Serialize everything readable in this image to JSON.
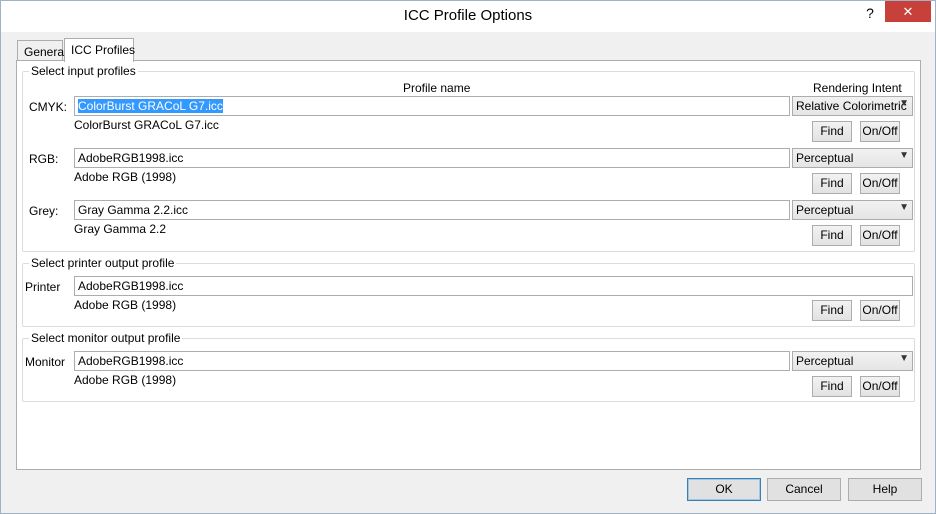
{
  "window": {
    "title": "ICC Profile Options",
    "help_glyph": "?",
    "close_glyph": "✕"
  },
  "tabs": [
    {
      "label": "General",
      "active": false
    },
    {
      "label": "ICC Profiles",
      "active": true
    }
  ],
  "input_group": {
    "label": "Select input profiles",
    "col_profile_name": "Profile name",
    "col_rendering_intent": "Rendering Intent",
    "rows": [
      {
        "label": "CMYK:",
        "value": "ColorBurst GRACoL G7.icc",
        "description": "ColorBurst GRACoL G7.icc",
        "intent": "Relative Colorimetric",
        "find": "Find",
        "onoff": "On/Off"
      },
      {
        "label": "RGB:",
        "value": "AdobeRGB1998.icc",
        "description": "Adobe RGB (1998)",
        "intent": "Perceptual",
        "find": "Find",
        "onoff": "On/Off"
      },
      {
        "label": "Grey:",
        "value": "Gray Gamma 2.2.icc",
        "description": "Gray Gamma 2.2",
        "intent": "Perceptual",
        "find": "Find",
        "onoff": "On/Off"
      }
    ]
  },
  "printer_group": {
    "label": "Select printer output profile",
    "row_label": "Printer",
    "value": "AdobeRGB1998.icc",
    "description": "Adobe RGB (1998)",
    "find": "Find",
    "onoff": "On/Off"
  },
  "monitor_group": {
    "label": "Select monitor output profile",
    "row_label": "Monitor",
    "value": "AdobeRGB1998.icc",
    "description": "Adobe RGB (1998)",
    "intent": "Perceptual",
    "find": "Find",
    "onoff": "On/Off"
  },
  "buttons": {
    "ok": "OK",
    "cancel": "Cancel",
    "help": "Help"
  },
  "colors": {
    "selection": "#3399ff",
    "close": "#c7403a"
  }
}
